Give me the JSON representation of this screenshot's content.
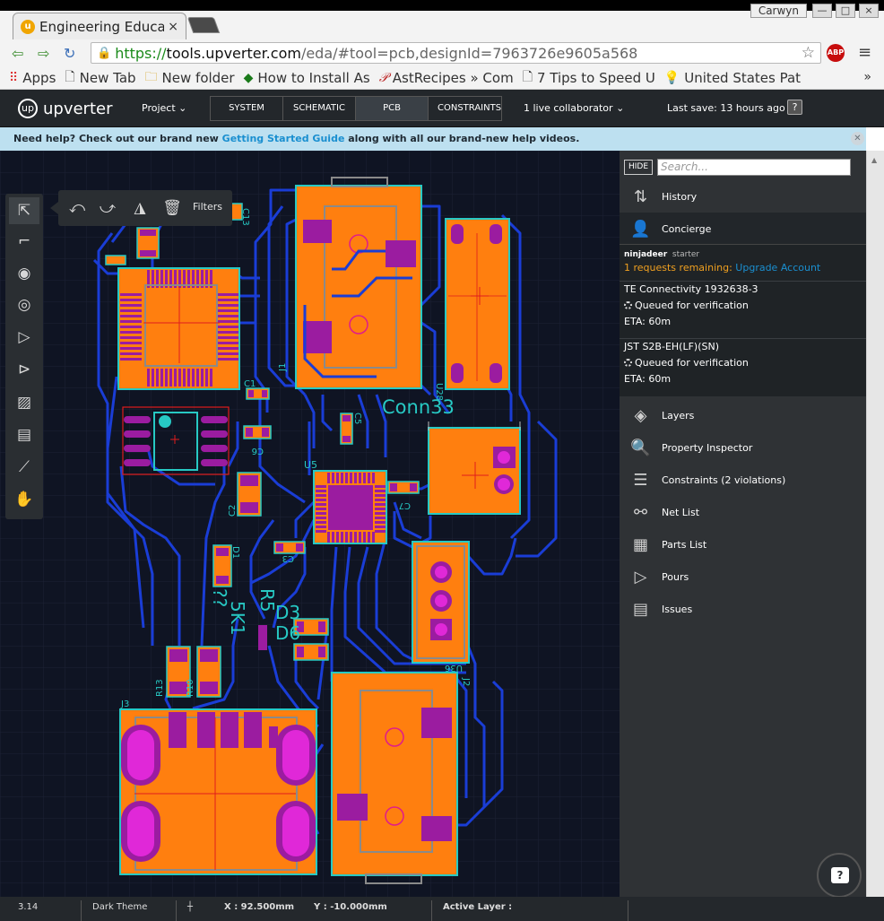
{
  "browser": {
    "tab_title": "Engineering Educat",
    "tab_close": "×",
    "window_user": "Carwyn",
    "url_scheme": "https://",
    "url_host": "tools.upverter.com",
    "url_path": "/eda/#tool=pcb,designId=7963726e9605a568",
    "abp_label": "ABP",
    "bookmarks": [
      "Apps",
      "New Tab",
      "New folder",
      "How to Install As",
      "AstRecipes » Com",
      "7 Tips to Speed U",
      "United States Pat"
    ],
    "bookmarks_more": "»"
  },
  "app": {
    "logo": "upverter",
    "project_menu": "Project",
    "mode_tabs": [
      "SYSTEM",
      "SCHEMATIC",
      "PCB LAYOUT",
      "CONSTRAINTS"
    ],
    "active_mode": "PCB LAYOUT",
    "collaborators": "1 live collaborator",
    "last_save": "Last save: 13 hours ago",
    "help_icon": "?"
  },
  "help_banner": {
    "prefix": "Need help? Check out our brand new ",
    "link": "Getting Started Guide",
    "suffix": " along with all our brand-new help videos."
  },
  "toolbar": {
    "filters_label": "Filters",
    "float_tools": [
      "undo-rotate-icon",
      "redo-rotate-icon",
      "flip-icon",
      "trash-icon"
    ],
    "left_tools": [
      "select-move-icon",
      "route-icon",
      "via-icon",
      "hole-icon",
      "pour-icon",
      "pour-outline-icon",
      "image-icon",
      "text-icon",
      "ruler-icon",
      "pan-hand-icon"
    ]
  },
  "pcb": {
    "labels": [
      "C13",
      "C1",
      "C5",
      "C6",
      "C2",
      "C3",
      "C7",
      "U5",
      "D1",
      "R13",
      "R10",
      "J3",
      "J1",
      "J2",
      "U36",
      "U28",
      "Conn33",
      "??",
      "5K1",
      "R5",
      "D3",
      "D6"
    ]
  },
  "panel": {
    "hide_label": "HIDE",
    "search_placeholder": "Search...",
    "history": "History",
    "concierge": "Concierge",
    "user": "ninjadeer",
    "plan": "starter",
    "requests_remaining": "1 requests remaining: ",
    "upgrade_link": "Upgrade Account",
    "requests": [
      {
        "name": "TE Connectivity 1932638-3",
        "status": "Queued for verification",
        "eta": "ETA: 60m"
      },
      {
        "name": "JST S2B-EH(LF)(SN)",
        "status": "Queued for verification",
        "eta": "ETA: 60m"
      }
    ],
    "menu": [
      "Layers",
      "Property Inspector",
      "Constraints (2 violations)",
      "Net List",
      "Parts List",
      "Pours",
      "Issues"
    ]
  },
  "status": {
    "zoom": "3.14",
    "theme": "Dark Theme",
    "x_coord": "X : 92.500mm",
    "y_coord": "Y : -10.000mm",
    "active_layer": "Active Layer :"
  },
  "colors": {
    "canvas_bg": "#0f1423",
    "copper": "#ff7f0f",
    "trace": "#1a3dd6",
    "pad": "#9b1ca0",
    "outline": "#27c9c4",
    "label": "#27c9c4",
    "link_blue": "#1a8fd0",
    "warn_orange": "#f0a020"
  }
}
